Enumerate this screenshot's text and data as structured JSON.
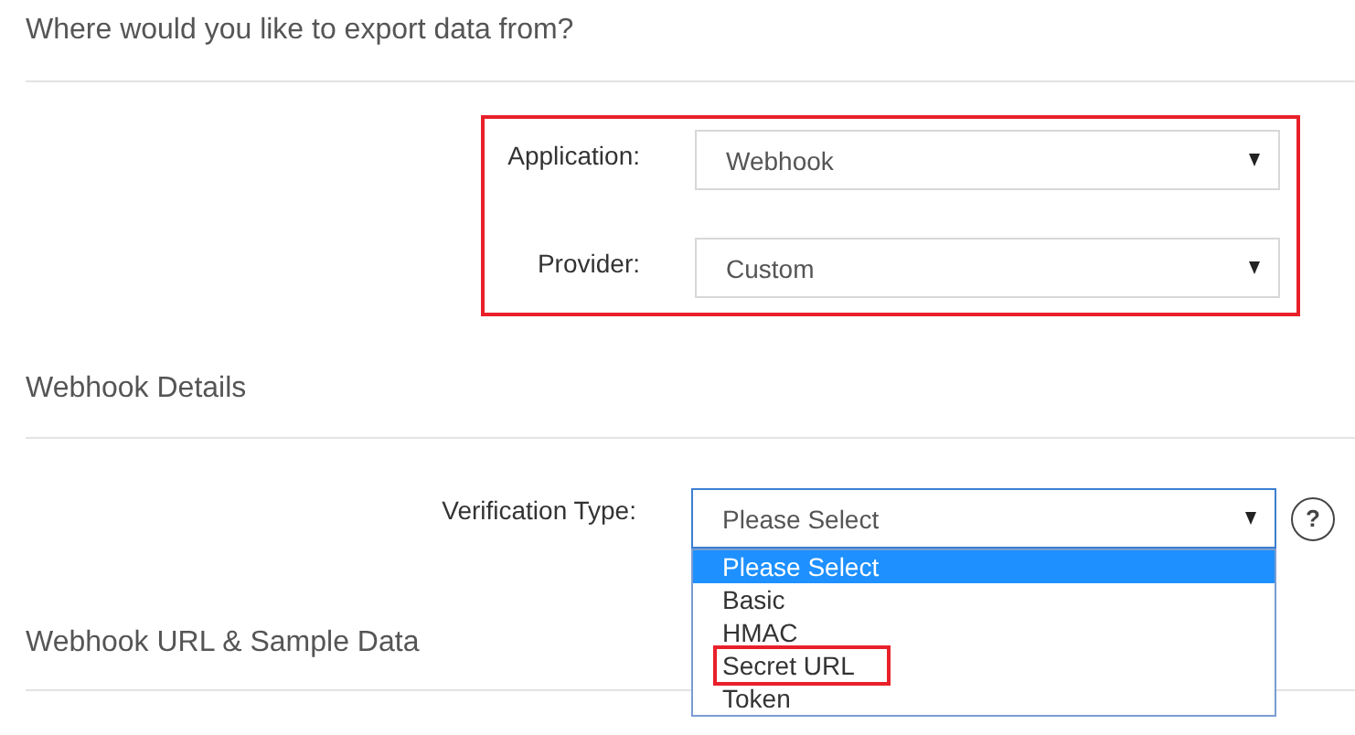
{
  "header": {
    "title": "Where would you like to export data from?"
  },
  "source_fields": {
    "highlighted": true,
    "fields": [
      {
        "label": "Application:",
        "value": "Webhook"
      },
      {
        "label": "Provider:",
        "value": "Custom"
      }
    ]
  },
  "webhook_details": {
    "title": "Webhook Details",
    "fields": [
      {
        "label": "Verification Type:",
        "value": "Please Select",
        "help": "?",
        "open": true,
        "options": [
          {
            "label": "Please Select",
            "selected": true,
            "highlighted": false
          },
          {
            "label": "Basic",
            "selected": false,
            "highlighted": false
          },
          {
            "label": "HMAC",
            "selected": false,
            "highlighted": false
          },
          {
            "label": "Secret URL",
            "selected": false,
            "highlighted": true
          },
          {
            "label": "Token",
            "selected": false,
            "highlighted": false
          }
        ]
      }
    ]
  },
  "next_section": {
    "title": "Webhook URL & Sample Data"
  }
}
